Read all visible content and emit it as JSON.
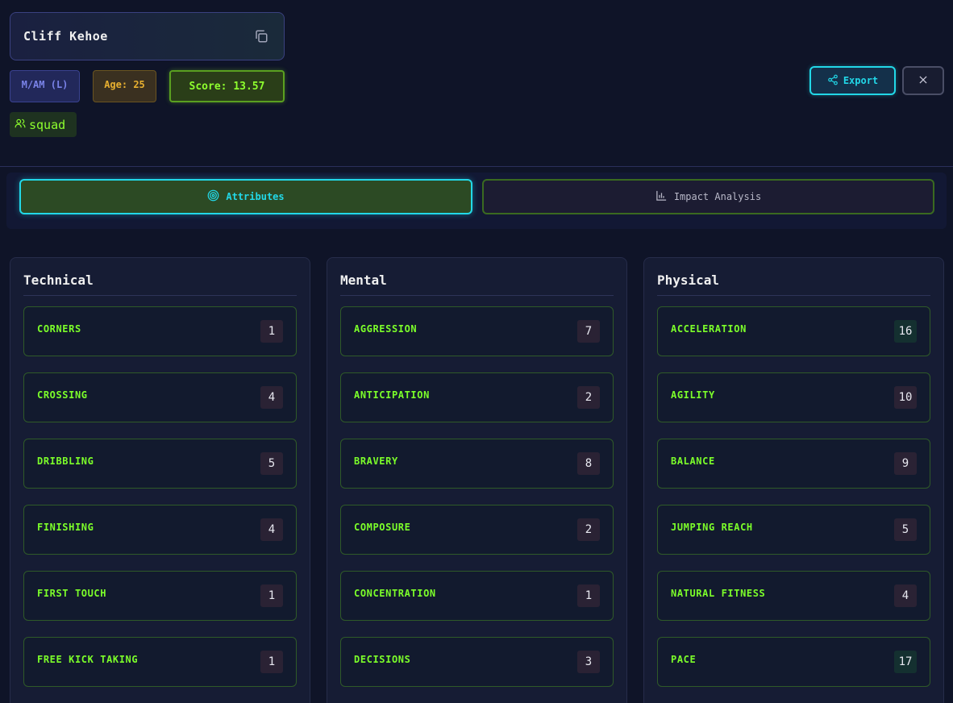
{
  "player": {
    "name": "Cliff Kehoe",
    "position": "M/AM (L)",
    "age": "Age: 25",
    "score": "Score: 13.57",
    "squad": "squad"
  },
  "actions": {
    "export_label": "Export"
  },
  "tabs": [
    {
      "label": "Attributes",
      "active": true
    },
    {
      "label": "Impact Analysis",
      "active": false
    }
  ],
  "columns": [
    {
      "title": "Technical",
      "items": [
        {
          "label": "CORNERS",
          "value": "1"
        },
        {
          "label": "CROSSING",
          "value": "4"
        },
        {
          "label": "DRIBBLING",
          "value": "5"
        },
        {
          "label": "FINISHING",
          "value": "4"
        },
        {
          "label": "FIRST TOUCH",
          "value": "1"
        },
        {
          "label": "FREE KICK TAKING",
          "value": "1"
        }
      ]
    },
    {
      "title": "Mental",
      "items": [
        {
          "label": "AGGRESSION",
          "value": "7"
        },
        {
          "label": "ANTICIPATION",
          "value": "2"
        },
        {
          "label": "BRAVERY",
          "value": "8"
        },
        {
          "label": "COMPOSURE",
          "value": "2"
        },
        {
          "label": "CONCENTRATION",
          "value": "1"
        },
        {
          "label": "DECISIONS",
          "value": "3"
        }
      ]
    },
    {
      "title": "Physical",
      "items": [
        {
          "label": "ACCELERATION",
          "value": "16"
        },
        {
          "label": "AGILITY",
          "value": "10"
        },
        {
          "label": "BALANCE",
          "value": "9"
        },
        {
          "label": "JUMPING REACH",
          "value": "5"
        },
        {
          "label": "NATURAL FITNESS",
          "value": "4"
        },
        {
          "label": "PACE",
          "value": "17"
        }
      ]
    }
  ],
  "colors": {
    "accent_cyan": "#22d8e8",
    "accent_green": "#7cff2a",
    "background": "#0f1428"
  }
}
